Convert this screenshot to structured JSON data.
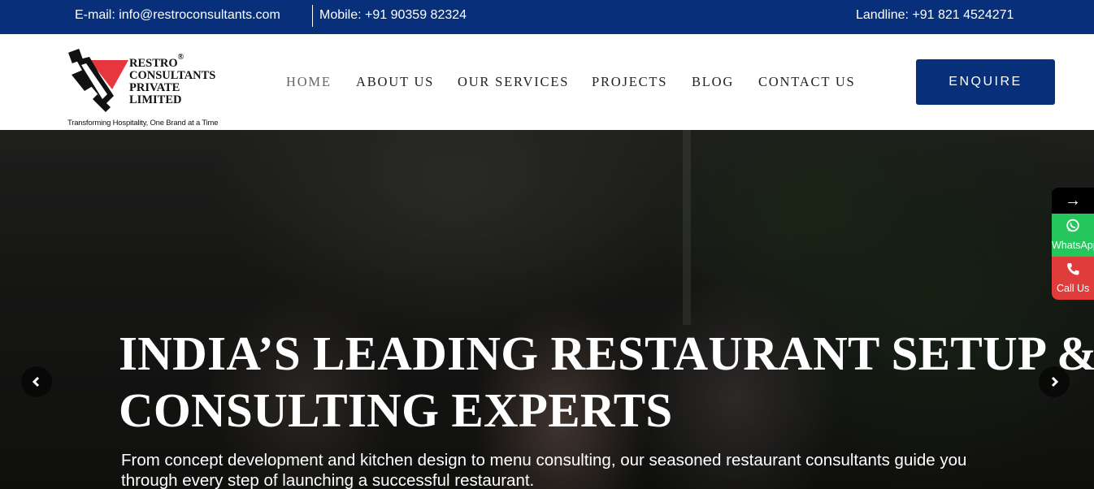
{
  "topbar": {
    "email": "E-mail: info@restroconsultants.com",
    "mobile": "Mobile: +91 90359 82324",
    "landline": "Landline: +91 821 4524271"
  },
  "logo": {
    "line1": "RESTRO",
    "registered": "®",
    "line2": "CONSULTANTS",
    "line3": "PRIVATE",
    "line4": "LIMITED",
    "tagline": "Transforming Hospitality, One Brand at a Time"
  },
  "nav": {
    "items": [
      {
        "label": "HOME"
      },
      {
        "label": "ABOUT US"
      },
      {
        "label": "OUR SERVICES"
      },
      {
        "label": "PROJECTS"
      },
      {
        "label": "BLOG"
      },
      {
        "label": "CONTACT US"
      }
    ],
    "active_item": "HOME"
  },
  "enquire_label": "ENQUIRE",
  "hero": {
    "title_line1": "INDIA’S LEADING RESTAURANT SETUP &",
    "title_line2": "CONSULTING EXPERTS",
    "subtitle": "From concept development and kitchen design to menu consulting, our seasoned restaurant consultants guide you through every step of launching a successful restaurant.",
    "prev_icon": "chevron-left-icon",
    "next_icon": "chevron-right-icon"
  },
  "side_widgets": {
    "toggle_icon": "arrow-right-icon",
    "toggle_glyph": "→",
    "whatsapp_label": "WhatsApp",
    "call_label": "Call Us"
  },
  "colors": {
    "brand_blue": "#072f7a",
    "whatsapp_green": "#25c65b",
    "call_red": "#e03c3c",
    "logo_red": "#e8363f"
  }
}
